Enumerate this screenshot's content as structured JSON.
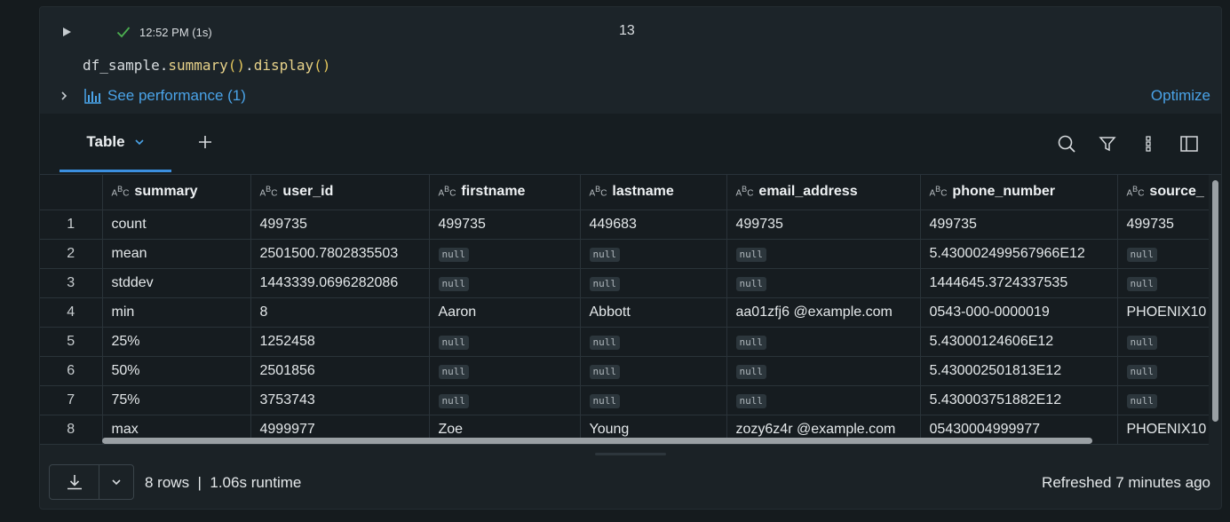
{
  "cell": {
    "status_time": "12:52 PM (1s)",
    "exec_count": "13",
    "code": {
      "obj": "df_sample",
      "fn1": "summary",
      "fn2": "display"
    },
    "perf_link": "See performance (1)",
    "optimize_label": "Optimize"
  },
  "tabs": {
    "active_label": "Table"
  },
  "grid": {
    "columns": [
      "summary",
      "user_id",
      "firstname",
      "lastname",
      "email_address",
      "phone_number",
      "source_"
    ],
    "rows": [
      {
        "n": "1",
        "cells": [
          "count",
          "499735",
          "499735",
          "449683",
          "499735",
          "499735",
          "499735"
        ]
      },
      {
        "n": "2",
        "cells": [
          "mean",
          "2501500.7802835503",
          "null",
          "null",
          "null",
          "5.430002499567966E12",
          "null"
        ]
      },
      {
        "n": "3",
        "cells": [
          "stddev",
          "1443339.0696282086",
          "null",
          "null",
          "null",
          "1444645.3724337535",
          "null"
        ]
      },
      {
        "n": "4",
        "cells": [
          "min",
          "8",
          "Aaron",
          "Abbott",
          "aa01zfj6   @example.com",
          "0543-000-0000019",
          "PHOENIX10"
        ]
      },
      {
        "n": "5",
        "cells": [
          "25%",
          "1252458",
          "null",
          "null",
          "null",
          "5.43000124606E12",
          "null"
        ]
      },
      {
        "n": "6",
        "cells": [
          "50%",
          "2501856",
          "null",
          "null",
          "null",
          "5.430002501813E12",
          "null"
        ]
      },
      {
        "n": "7",
        "cells": [
          "75%",
          "3753743",
          "null",
          "null",
          "null",
          "5.430003751882E12",
          "null"
        ]
      },
      {
        "n": "8",
        "cells": [
          "max",
          "4999977",
          "Zoe",
          "Young",
          "zozy6z4r @example.com",
          "05430004999977",
          "PHOENIX10"
        ]
      }
    ]
  },
  "footer": {
    "rows_info": "8 rows  |  1.06s runtime",
    "refreshed": "Refreshed 7 minutes ago"
  },
  "colors": {
    "accent": "#4aa3e8",
    "success": "#4caf50",
    "null_badge_bg": "#2c363c"
  }
}
